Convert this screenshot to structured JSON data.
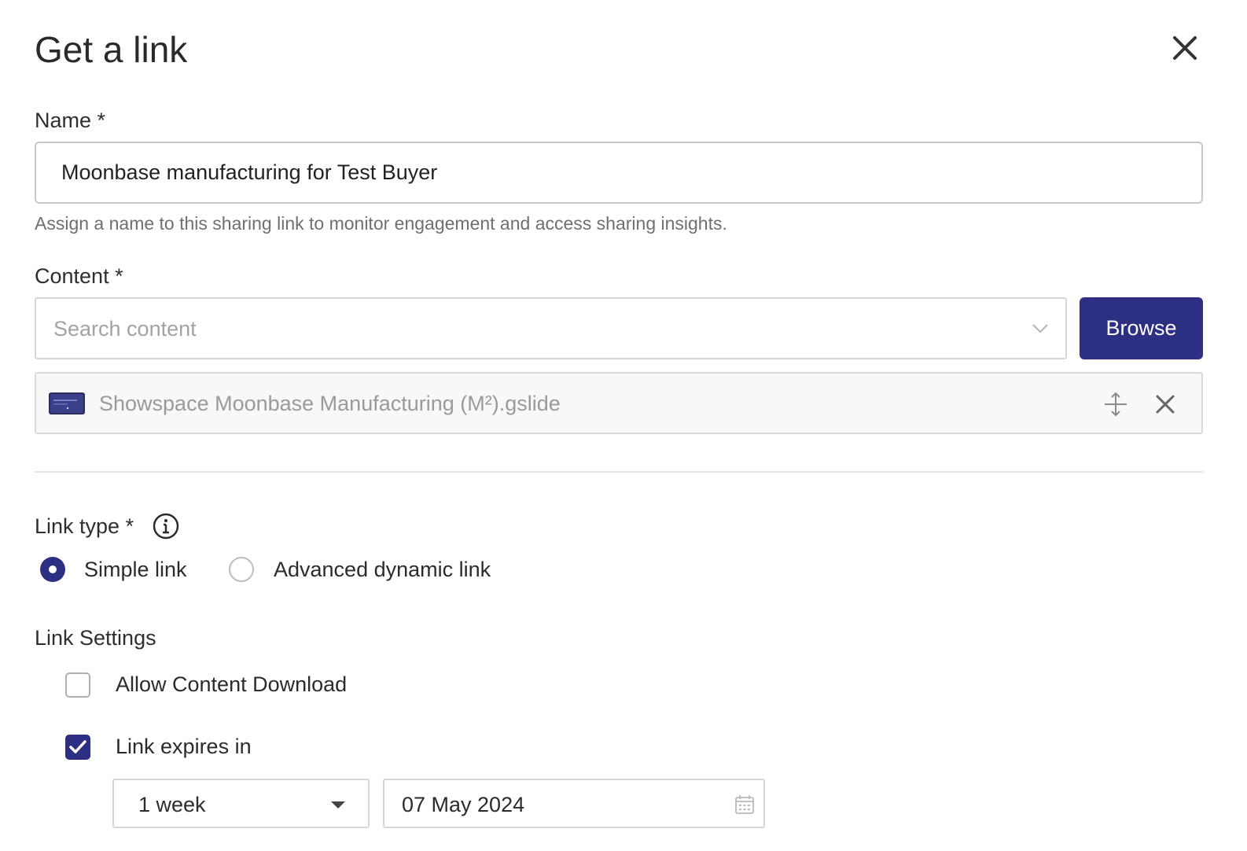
{
  "dialog": {
    "title": "Get a link"
  },
  "name_field": {
    "label": "Name *",
    "value": "Moonbase manufacturing for Test Buyer",
    "helper": "Assign a name to this sharing link to monitor engagement and access sharing insights."
  },
  "content_field": {
    "label": "Content *",
    "placeholder": "Search content",
    "browse_label": "Browse",
    "selected_item": "Showspace Moonbase Manufacturing (M²).gslide"
  },
  "link_type": {
    "label": "Link type *",
    "options": [
      {
        "label": "Simple link",
        "selected": true
      },
      {
        "label": "Advanced dynamic link",
        "selected": false
      }
    ]
  },
  "link_settings": {
    "heading": "Link Settings",
    "allow_download": {
      "label": "Allow Content Download",
      "checked": false
    },
    "expires": {
      "label": "Link expires in",
      "checked": true
    },
    "duration": "1 week",
    "date": "07 May 2024"
  },
  "colors": {
    "accent": "#2c2f82",
    "border": "#c8c8c8",
    "helper_text": "#6f6f6f"
  },
  "icons": {
    "close": "close-icon",
    "info": "info-icon",
    "dropdown": "chevron-down-icon",
    "reorder": "drag-handle-icon",
    "remove": "remove-icon",
    "calendar": "calendar-icon",
    "thumbnail": "slide-thumbnail-icon"
  }
}
